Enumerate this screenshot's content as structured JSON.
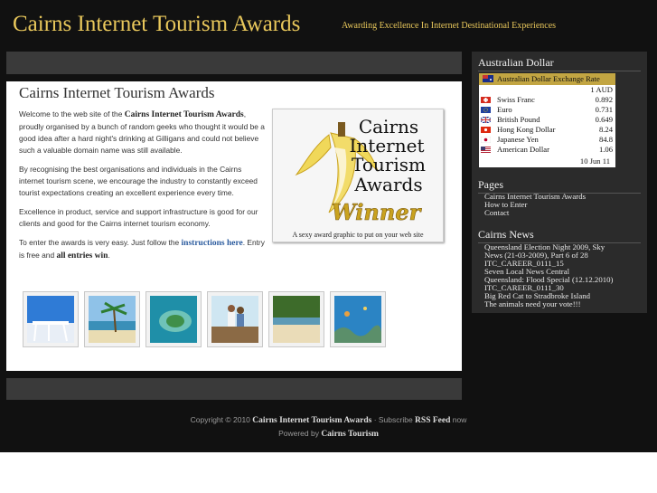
{
  "header": {
    "site_title": "Cairns Internet Tourism Awards",
    "tagline": "Awarding Excellence In Internet Destinational Experiences"
  },
  "main": {
    "heading": "Cairns Internet Tourism Awards",
    "p1_before": "Welcome to the web site of the ",
    "p1_bold": "Cairns Internet Tourism Awards",
    "p1_after": ", proudly organised by a bunch of random geeks who thought it would be a good idea after a hard night's drinking at Gilligans and could not believe such a valuable domain name was still available.",
    "p2": "By recognising the best organisations and individuals in the Cairns internet tourism scene, we encourage the industry to constantly exceed tourist expectations creating an excellent experience every time.",
    "p3": "Excellence in product, service and support infrastructure is good for our clients and good for the Cairns internet tourism economy.",
    "p4_before": "To enter the awards is very easy. Just follow the ",
    "p4_link": "instructions here",
    "p4_mid": ". Entry is free and ",
    "p4_bold": "all entries win",
    "p4_end": ".",
    "award_image": {
      "line1": "Cairns",
      "line2": "Internet",
      "line3": "Tourism",
      "line4": "Awards",
      "line5": "Winner",
      "caption": "A sexy award graphic to put on your web site"
    },
    "thumbnails": [
      "beach-pier-photo",
      "palm-tree-beach-photo",
      "island-aerial-photo",
      "couple-jetty-photo",
      "rainforest-beach-photo",
      "coral-reef-photo"
    ]
  },
  "footer": {
    "copy_prefix": "Copyright © 2010 ",
    "copy_site": "Cairns Internet Tourism Awards",
    "subscribe_text": " · Subscribe ",
    "rss": "RSS Feed",
    "now": " now",
    "powered_prefix": "Powered by ",
    "powered_site": "Cairns Tourism"
  },
  "sidebar": {
    "dollar_heading": "Australian Dollar",
    "fx_title": "Australian Dollar Exchange Rate",
    "fx_base": "1 AUD",
    "fx_rows": [
      {
        "name": "Swiss Franc",
        "value": "0.892",
        "flag": "swiss-flag-icon"
      },
      {
        "name": "Euro",
        "value": "0.731",
        "flag": "eu-flag-icon"
      },
      {
        "name": "British Pound",
        "value": "0.649",
        "flag": "uk-flag-icon"
      },
      {
        "name": "Hong Kong Dollar",
        "value": "8.24",
        "flag": "hong-kong-flag-icon"
      },
      {
        "name": "Japanese Yen",
        "value": "84.8",
        "flag": "japan-flag-icon"
      },
      {
        "name": "American Dollar",
        "value": "1.06",
        "flag": "us-flag-icon"
      }
    ],
    "fx_date": "10 Jun 11",
    "pages_heading": "Pages",
    "pages": [
      "Cairns Internet Tourism Awards",
      "How to Enter",
      "Contact"
    ],
    "news_heading": "Cairns News",
    "news": [
      "Queensland Election Night 2009, Sky",
      "News (21-03-2009), Part 6 of 28",
      "ITC_CAREER_0111_15",
      "Seven Local News Central",
      "Queensland: Flood Special (12.12.2010)",
      "ITC_CAREER_0111_30",
      "Big Red Cat to Stradbroke Island",
      "The animals need your vote!!!"
    ]
  },
  "colors": {
    "background": "#111111",
    "accent_gold": "#e8c75b",
    "fx_header": "#c2a542",
    "panel": "#2b2b2b",
    "bar": "#3a3a3a",
    "link": "#2b5b9e"
  }
}
